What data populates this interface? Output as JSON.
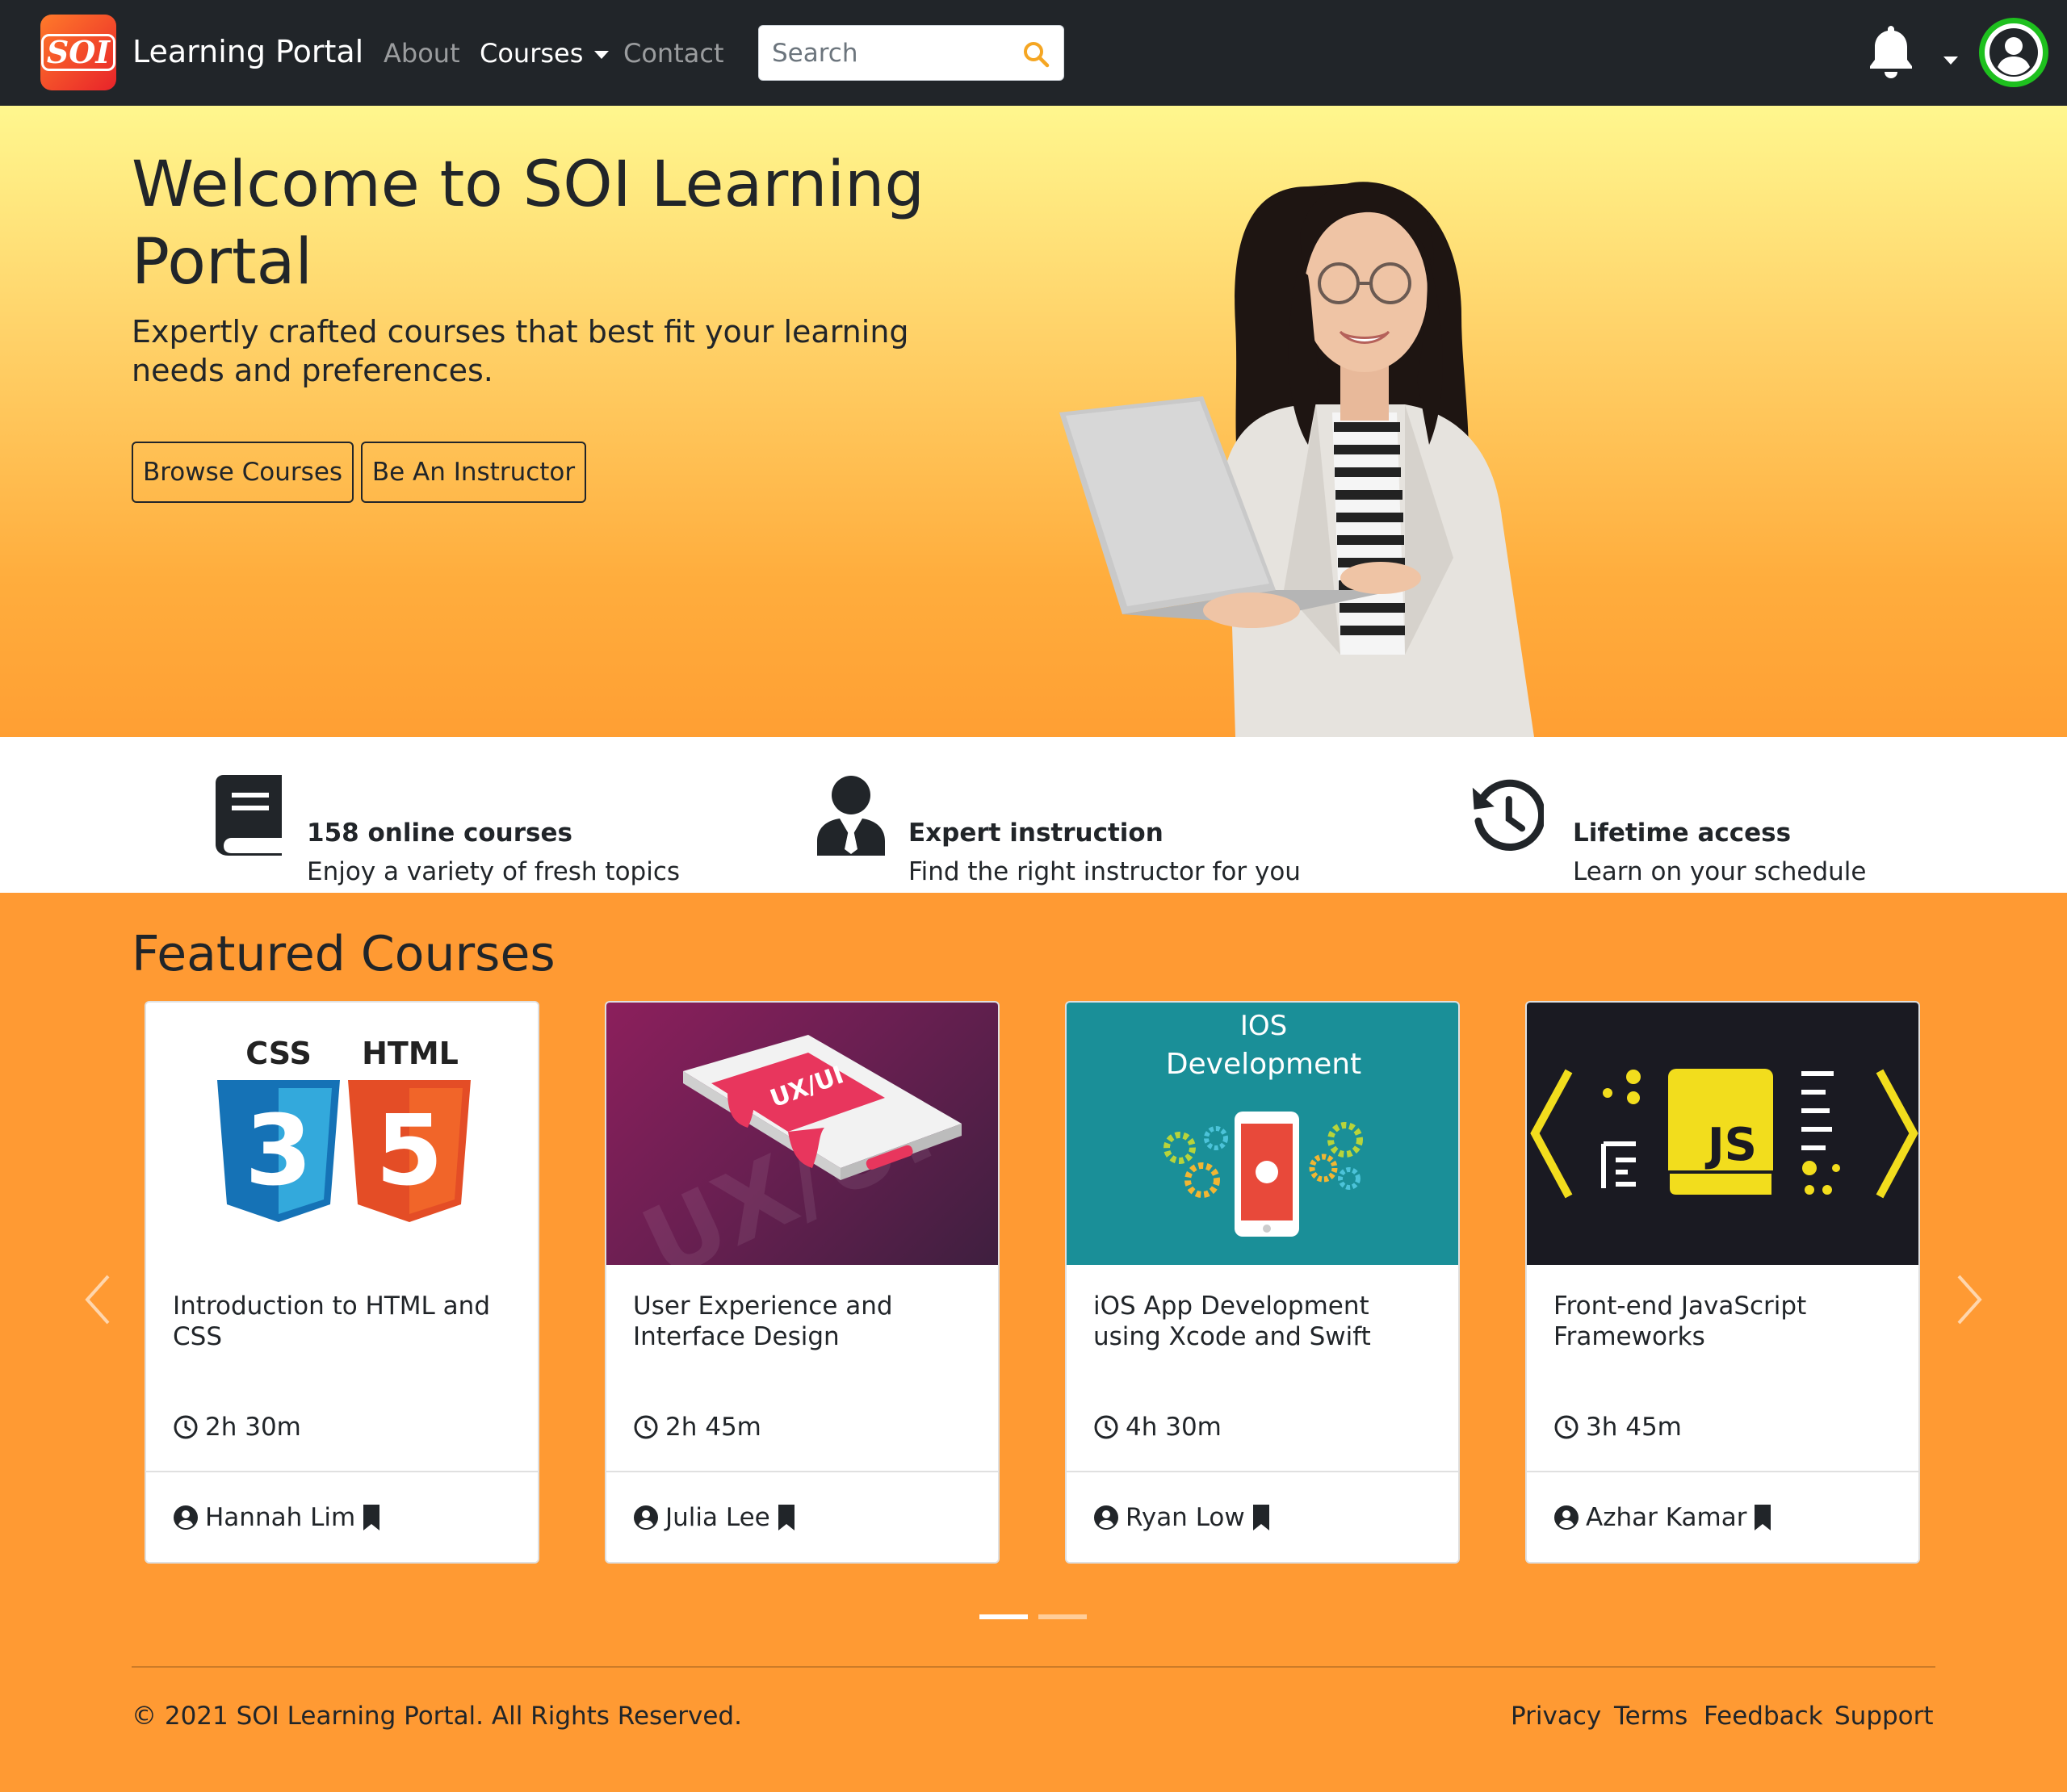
{
  "nav": {
    "logo_text": "SOI",
    "brand": "Learning Portal",
    "links": [
      "About",
      "Courses",
      "Contact"
    ],
    "search_placeholder": "Search"
  },
  "hero": {
    "title": "Welcome to SOI Learning Portal",
    "subtitle": "Expertly crafted courses that best fit your learning needs and preferences.",
    "btn_browse": "Browse Courses",
    "btn_instructor": "Be An Instructor"
  },
  "features": [
    {
      "icon": "book-icon",
      "title": "158 online courses",
      "desc": "Enjoy a variety of fresh topics"
    },
    {
      "icon": "user-tie-icon",
      "title": "Expert instruction",
      "desc": "Find the right instructor for you"
    },
    {
      "icon": "history-icon",
      "title": "Lifetime access",
      "desc": "Learn on your schedule"
    }
  ],
  "featured": {
    "title": "Featured Courses",
    "courses": [
      {
        "image_text": [
          "CSS",
          "HTML"
        ],
        "title": "Introduction to HTML and CSS",
        "duration": "2h 30m",
        "author": "Hannah Lim"
      },
      {
        "image_text": [
          "UX/UI"
        ],
        "title": "User Experience and Interface Design",
        "duration": "2h 45m",
        "author": "Julia Lee"
      },
      {
        "image_text": [
          "IOS",
          "Development"
        ],
        "title": "iOS App Development using Xcode and Swift",
        "duration": "4h 30m",
        "author": "Ryan Low"
      },
      {
        "image_text": [
          "JS"
        ],
        "title": "Front-end JavaScript Frameworks",
        "duration": "3h 45m",
        "author": "Azhar Kamar"
      }
    ]
  },
  "footer": {
    "copyright": "© 2021 SOI Learning Portal. All Rights Reserved.",
    "links": [
      "Privacy",
      "Terms",
      "Feedback",
      "Support"
    ]
  },
  "colors": {
    "navbar": "#212529",
    "accent_orange": "#ff9a33",
    "avatar_ring": "#1ec01e",
    "search_icon": "#f5a623"
  }
}
